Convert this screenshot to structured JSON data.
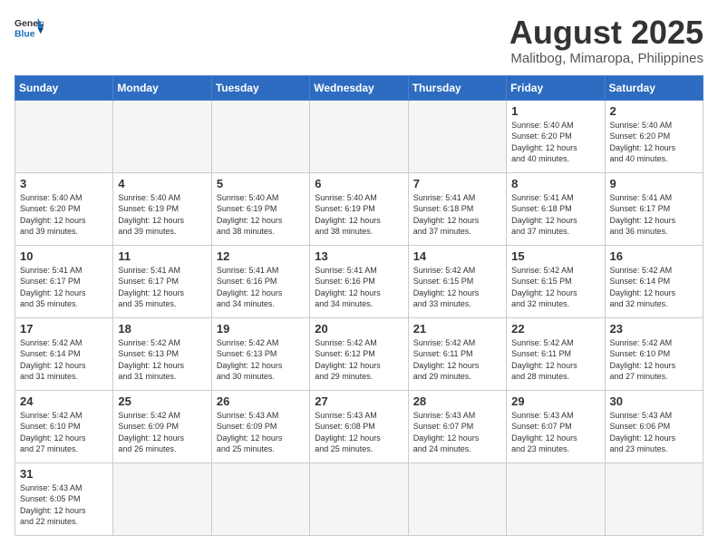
{
  "header": {
    "logo_general": "General",
    "logo_blue": "Blue",
    "title": "August 2025",
    "subtitle": "Malitbog, Mimaropa, Philippines"
  },
  "weekdays": [
    "Sunday",
    "Monday",
    "Tuesday",
    "Wednesday",
    "Thursday",
    "Friday",
    "Saturday"
  ],
  "weeks": [
    [
      {
        "day": "",
        "info": ""
      },
      {
        "day": "",
        "info": ""
      },
      {
        "day": "",
        "info": ""
      },
      {
        "day": "",
        "info": ""
      },
      {
        "day": "",
        "info": ""
      },
      {
        "day": "1",
        "info": "Sunrise: 5:40 AM\nSunset: 6:20 PM\nDaylight: 12 hours\nand 40 minutes."
      },
      {
        "day": "2",
        "info": "Sunrise: 5:40 AM\nSunset: 6:20 PM\nDaylight: 12 hours\nand 40 minutes."
      }
    ],
    [
      {
        "day": "3",
        "info": "Sunrise: 5:40 AM\nSunset: 6:20 PM\nDaylight: 12 hours\nand 39 minutes."
      },
      {
        "day": "4",
        "info": "Sunrise: 5:40 AM\nSunset: 6:19 PM\nDaylight: 12 hours\nand 39 minutes."
      },
      {
        "day": "5",
        "info": "Sunrise: 5:40 AM\nSunset: 6:19 PM\nDaylight: 12 hours\nand 38 minutes."
      },
      {
        "day": "6",
        "info": "Sunrise: 5:40 AM\nSunset: 6:19 PM\nDaylight: 12 hours\nand 38 minutes."
      },
      {
        "day": "7",
        "info": "Sunrise: 5:41 AM\nSunset: 6:18 PM\nDaylight: 12 hours\nand 37 minutes."
      },
      {
        "day": "8",
        "info": "Sunrise: 5:41 AM\nSunset: 6:18 PM\nDaylight: 12 hours\nand 37 minutes."
      },
      {
        "day": "9",
        "info": "Sunrise: 5:41 AM\nSunset: 6:17 PM\nDaylight: 12 hours\nand 36 minutes."
      }
    ],
    [
      {
        "day": "10",
        "info": "Sunrise: 5:41 AM\nSunset: 6:17 PM\nDaylight: 12 hours\nand 35 minutes."
      },
      {
        "day": "11",
        "info": "Sunrise: 5:41 AM\nSunset: 6:17 PM\nDaylight: 12 hours\nand 35 minutes."
      },
      {
        "day": "12",
        "info": "Sunrise: 5:41 AM\nSunset: 6:16 PM\nDaylight: 12 hours\nand 34 minutes."
      },
      {
        "day": "13",
        "info": "Sunrise: 5:41 AM\nSunset: 6:16 PM\nDaylight: 12 hours\nand 34 minutes."
      },
      {
        "day": "14",
        "info": "Sunrise: 5:42 AM\nSunset: 6:15 PM\nDaylight: 12 hours\nand 33 minutes."
      },
      {
        "day": "15",
        "info": "Sunrise: 5:42 AM\nSunset: 6:15 PM\nDaylight: 12 hours\nand 32 minutes."
      },
      {
        "day": "16",
        "info": "Sunrise: 5:42 AM\nSunset: 6:14 PM\nDaylight: 12 hours\nand 32 minutes."
      }
    ],
    [
      {
        "day": "17",
        "info": "Sunrise: 5:42 AM\nSunset: 6:14 PM\nDaylight: 12 hours\nand 31 minutes."
      },
      {
        "day": "18",
        "info": "Sunrise: 5:42 AM\nSunset: 6:13 PM\nDaylight: 12 hours\nand 31 minutes."
      },
      {
        "day": "19",
        "info": "Sunrise: 5:42 AM\nSunset: 6:13 PM\nDaylight: 12 hours\nand 30 minutes."
      },
      {
        "day": "20",
        "info": "Sunrise: 5:42 AM\nSunset: 6:12 PM\nDaylight: 12 hours\nand 29 minutes."
      },
      {
        "day": "21",
        "info": "Sunrise: 5:42 AM\nSunset: 6:11 PM\nDaylight: 12 hours\nand 29 minutes."
      },
      {
        "day": "22",
        "info": "Sunrise: 5:42 AM\nSunset: 6:11 PM\nDaylight: 12 hours\nand 28 minutes."
      },
      {
        "day": "23",
        "info": "Sunrise: 5:42 AM\nSunset: 6:10 PM\nDaylight: 12 hours\nand 27 minutes."
      }
    ],
    [
      {
        "day": "24",
        "info": "Sunrise: 5:42 AM\nSunset: 6:10 PM\nDaylight: 12 hours\nand 27 minutes."
      },
      {
        "day": "25",
        "info": "Sunrise: 5:42 AM\nSunset: 6:09 PM\nDaylight: 12 hours\nand 26 minutes."
      },
      {
        "day": "26",
        "info": "Sunrise: 5:43 AM\nSunset: 6:09 PM\nDaylight: 12 hours\nand 25 minutes."
      },
      {
        "day": "27",
        "info": "Sunrise: 5:43 AM\nSunset: 6:08 PM\nDaylight: 12 hours\nand 25 minutes."
      },
      {
        "day": "28",
        "info": "Sunrise: 5:43 AM\nSunset: 6:07 PM\nDaylight: 12 hours\nand 24 minutes."
      },
      {
        "day": "29",
        "info": "Sunrise: 5:43 AM\nSunset: 6:07 PM\nDaylight: 12 hours\nand 23 minutes."
      },
      {
        "day": "30",
        "info": "Sunrise: 5:43 AM\nSunset: 6:06 PM\nDaylight: 12 hours\nand 23 minutes."
      }
    ],
    [
      {
        "day": "31",
        "info": "Sunrise: 5:43 AM\nSunset: 6:05 PM\nDaylight: 12 hours\nand 22 minutes."
      },
      {
        "day": "",
        "info": ""
      },
      {
        "day": "",
        "info": ""
      },
      {
        "day": "",
        "info": ""
      },
      {
        "day": "",
        "info": ""
      },
      {
        "day": "",
        "info": ""
      },
      {
        "day": "",
        "info": ""
      }
    ]
  ]
}
